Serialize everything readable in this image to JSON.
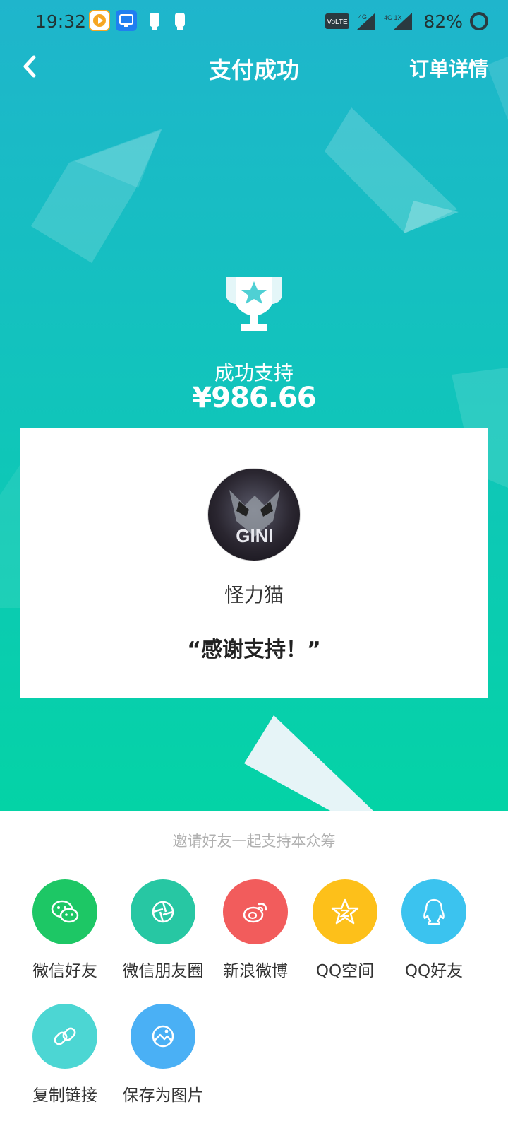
{
  "status_bar": {
    "time": "19:32",
    "network_labels": [
      "VoLTE",
      "4G",
      "4G 1X"
    ],
    "battery": "82%"
  },
  "header": {
    "title": "支付成功",
    "right_action": "订单详情",
    "back_icon": "chevron-left-icon"
  },
  "payment": {
    "label": "成功支持",
    "amount": "¥986.66"
  },
  "card": {
    "creator_name": "怪力猫",
    "avatar_text": "GINI",
    "message": "“感谢支持！”"
  },
  "share": {
    "invite_text": "邀请好友一起支持本众筹",
    "items": [
      {
        "label": "微信好友",
        "icon": "wechat-icon",
        "color": "#1dc765"
      },
      {
        "label": "微信朋友圈",
        "icon": "moments-icon",
        "color": "#27c7a3"
      },
      {
        "label": "新浪微博",
        "icon": "weibo-icon",
        "color": "#f25c5c"
      },
      {
        "label": "QQ空间",
        "icon": "qzone-icon",
        "color": "#fdc01a"
      },
      {
        "label": "QQ好友",
        "icon": "qq-icon",
        "color": "#3bc3ef"
      },
      {
        "label": "复制链接",
        "icon": "link-icon",
        "color": "#4cd6d3"
      },
      {
        "label": "保存为图片",
        "icon": "image-icon",
        "color": "#4ab0f5"
      }
    ]
  },
  "colors": {
    "gradient_top": "#1fb5cc",
    "gradient_bottom": "#04d3a6"
  }
}
